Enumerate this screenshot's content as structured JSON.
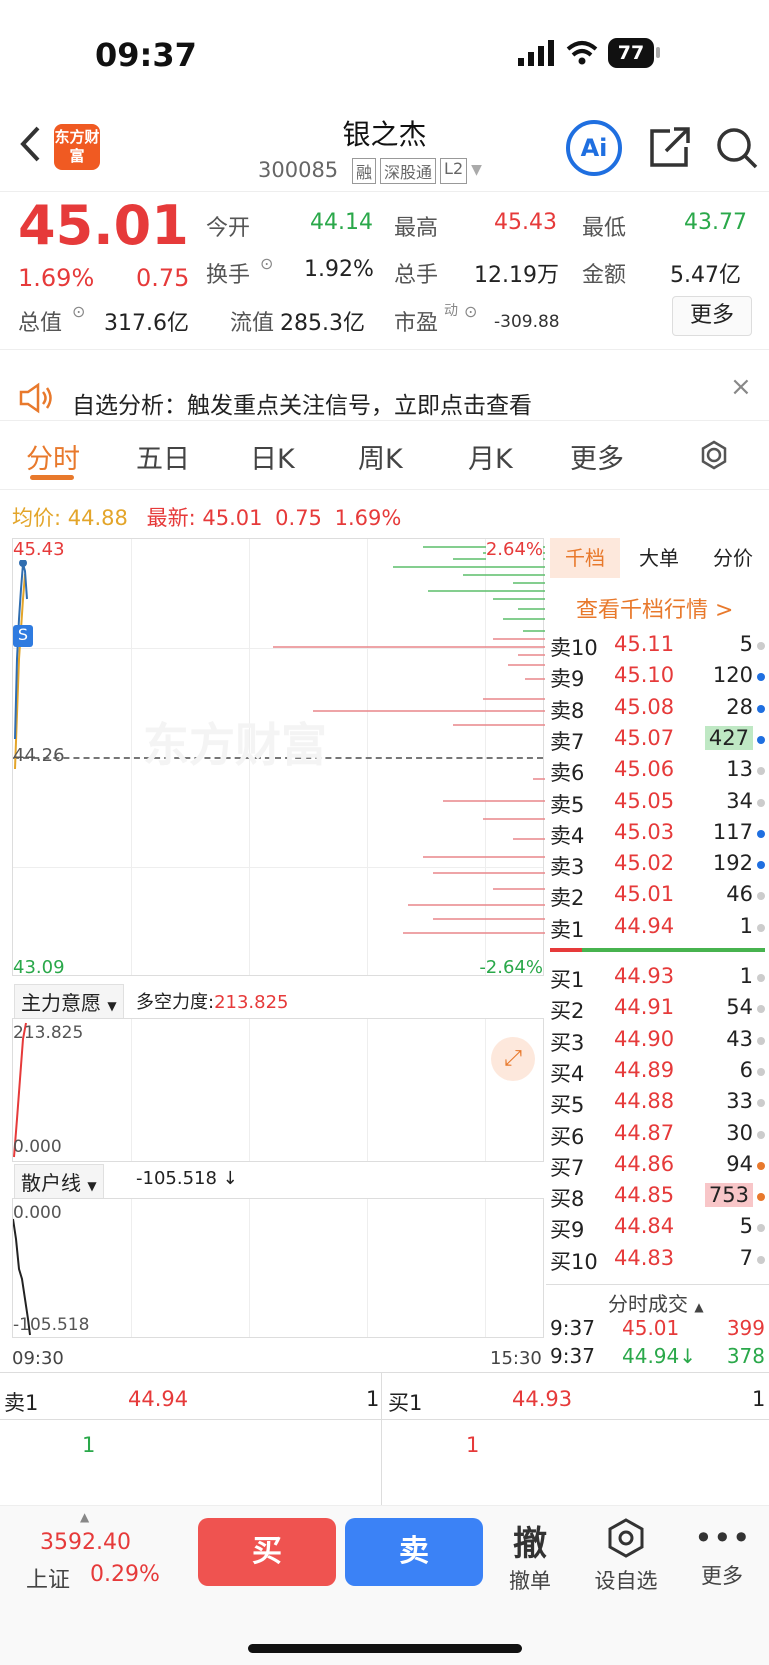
{
  "status": {
    "time": "09:37",
    "battery": "77"
  },
  "header": {
    "logo": "东方财富",
    "title": "银之杰",
    "code": "300085",
    "tags": [
      "融",
      "深股通",
      "L2"
    ],
    "ai": "Ai"
  },
  "quote": {
    "price": "45.01",
    "pct": "1.69%",
    "chg": "0.75",
    "open_label": "今开",
    "open": "44.14",
    "high_label": "最高",
    "high": "45.43",
    "low_label": "最低",
    "low": "43.77",
    "turnover_label": "换手",
    "turnover": "1.92%",
    "vol_label": "总手",
    "vol": "12.19万",
    "amt_label": "金额",
    "amt": "5.47亿",
    "mcap_label": "总值",
    "mcap": "317.6亿",
    "float_label": "流值",
    "float": "285.3亿",
    "pe_label": "市盈",
    "pe_sup": "动",
    "pe": "-309.88",
    "more": "更多"
  },
  "notice": {
    "text": "自选分析：触发重点关注信号，立即点击查看"
  },
  "tabs": [
    "分时",
    "五日",
    "日K",
    "周K",
    "月K",
    "更多"
  ],
  "info": {
    "avg_label": "均价:",
    "avg": "44.88",
    "last_label": "最新:",
    "last": "45.01",
    "chg": "0.75",
    "pct": "1.69%"
  },
  "chart": {
    "ymax": "45.43",
    "ymid": "44.26",
    "ymin": "43.09",
    "pmax": "2.64%",
    "pmin": "-2.64%",
    "watermark": "东方财富",
    "marker": "S",
    "xstart": "09:30",
    "xend": "15:30"
  },
  "sidebar": {
    "tabs": [
      "千档",
      "大单",
      "分价"
    ],
    "link": "查看千档行情 >"
  },
  "asks": [
    {
      "l": "卖10",
      "p": "45.11",
      "q": "5",
      "dot": "#ccc"
    },
    {
      "l": "卖9",
      "p": "45.10",
      "q": "120",
      "dot": "#1f6fe0"
    },
    {
      "l": "卖8",
      "p": "45.08",
      "q": "28",
      "dot": "#1f6fe0"
    },
    {
      "l": "卖7",
      "p": "45.07",
      "q": "427",
      "dot": "#1f6fe0"
    },
    {
      "l": "卖6",
      "p": "45.06",
      "q": "13",
      "dot": "#ccc"
    },
    {
      "l": "卖5",
      "p": "45.05",
      "q": "34",
      "dot": "#ccc"
    },
    {
      "l": "卖4",
      "p": "45.03",
      "q": "117",
      "dot": "#1f6fe0"
    },
    {
      "l": "卖3",
      "p": "45.02",
      "q": "192",
      "dot": "#1f6fe0"
    },
    {
      "l": "卖2",
      "p": "45.01",
      "q": "46",
      "dot": "#ccc"
    },
    {
      "l": "卖1",
      "p": "44.94",
      "q": "1",
      "dot": "#ccc"
    }
  ],
  "bids": [
    {
      "l": "买1",
      "p": "44.93",
      "q": "1",
      "dot": "#ccc"
    },
    {
      "l": "买2",
      "p": "44.91",
      "q": "54",
      "dot": "#ccc"
    },
    {
      "l": "买3",
      "p": "44.90",
      "q": "43",
      "dot": "#ccc"
    },
    {
      "l": "买4",
      "p": "44.89",
      "q": "6",
      "dot": "#ccc"
    },
    {
      "l": "买5",
      "p": "44.88",
      "q": "33",
      "dot": "#ccc"
    },
    {
      "l": "买6",
      "p": "44.87",
      "q": "30",
      "dot": "#ccc"
    },
    {
      "l": "买7",
      "p": "44.86",
      "q": "94",
      "dot": "#e8792c"
    },
    {
      "l": "买8",
      "p": "44.85",
      "q": "753",
      "dot": "#e8792c"
    },
    {
      "l": "买9",
      "p": "44.84",
      "q": "5",
      "dot": "#ccc"
    },
    {
      "l": "买10",
      "p": "44.83",
      "q": "7",
      "dot": "#ccc"
    }
  ],
  "trades": {
    "title": "分时成交",
    "rows": [
      {
        "t": "9:37",
        "p": "45.01",
        "q": "399"
      },
      {
        "t": "9:37",
        "p": "44.94↓",
        "q": "378"
      }
    ]
  },
  "ind1": {
    "name": "主力意愿",
    "label": "多空力度:",
    "value": "213.825",
    "top": "213.825",
    "bottom": "0.000"
  },
  "ind2": {
    "name": "散户线",
    "value": "-105.518 ↓",
    "top": "0.000",
    "bottom": "-105.518"
  },
  "l1": {
    "ask_label": "卖1",
    "ask": "44.94",
    "ask_q": "1",
    "bid_label": "买1",
    "bid": "44.93",
    "bid_q": "1",
    "ask_cnt": "1",
    "bid_cnt": "1"
  },
  "bottom": {
    "index": "3592.40",
    "index_name": "上证",
    "index_pct": "0.29%",
    "buy": "买",
    "sell": "卖",
    "cancel_icon": "撤",
    "cancel": "撤单",
    "fav": "设自选",
    "more": "更多"
  }
}
